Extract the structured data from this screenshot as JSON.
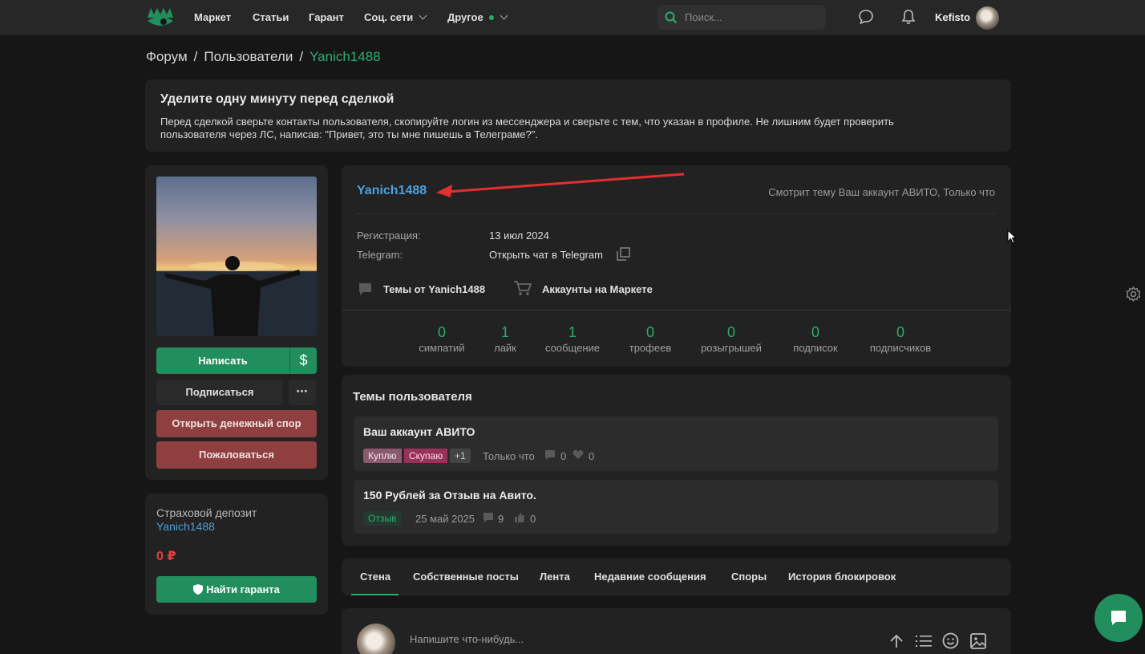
{
  "nav": {
    "items": [
      "Маркет",
      "Статьи",
      "Гарант",
      "Соц. сети",
      "Другое"
    ],
    "search_placeholder": "Поиск...",
    "username": "Kefisto"
  },
  "breadcrumb": [
    "Форум",
    "Пользователи",
    "Yanich1488"
  ],
  "notice": {
    "title": "Уделите одну минуту перед сделкой",
    "text": "Перед сделкой сверьте контакты пользователя, скопируйте логин из мессенджера и сверьте с тем, что указан в профиле. Не лишним будет проверить пользователя через ЛС, написав: \"Привет, это ты мне пишешь в Телеграме?\"."
  },
  "sidebar": {
    "write": "Написать",
    "currency_icon": "$",
    "subscribe": "Подписаться",
    "more": "•••",
    "dispute": "Открыть денежный спор",
    "report": "Пожаловаться",
    "deposit_title": "Страховой депозит",
    "deposit_user": "Yanich1488",
    "deposit_amount": "0 ₽",
    "find_guarantor": "Найти гаранта"
  },
  "profile": {
    "name": "Yanich1488",
    "status": "Смотрит тему Ваш аккаунт АВИТО, Только что",
    "reg_label": "Регистрация:",
    "reg_value": "13 июл 2024",
    "tg_label": "Telegram:",
    "tg_value": "Открыть чат в Telegram",
    "threads_link": "Темы от Yanich1488",
    "market_link": "Аккаунты на Маркете",
    "stats": [
      {
        "num": "0",
        "label": "симпатий"
      },
      {
        "num": "1",
        "label": "лайк"
      },
      {
        "num": "1",
        "label": "сообщение"
      },
      {
        "num": "0",
        "label": "трофеев"
      },
      {
        "num": "0",
        "label": "розыгрышей"
      },
      {
        "num": "0",
        "label": "подписок"
      },
      {
        "num": "0",
        "label": "подписчиков"
      }
    ]
  },
  "threads": {
    "title": "Темы пользователя",
    "items": [
      {
        "title": "Ваш аккаунт АВИТО",
        "tags": [
          "Куплю",
          "Скупаю",
          "+1"
        ],
        "time": "Только что",
        "replies": "0",
        "likes": "0"
      },
      {
        "title": "150 Рублей за Отзыв на Авито.",
        "tags": [
          "Отзыв"
        ],
        "time": "25 май 2025",
        "replies": "9",
        "likes": "0"
      }
    ]
  },
  "tabs": [
    "Стена",
    "Собственные посты",
    "Лента",
    "Недавние сообщения",
    "Споры",
    "История блокировок"
  ],
  "composer": {
    "placeholder": "Напишите что-нибудь..."
  },
  "colors": {
    "accent": "#2bad72",
    "link": "#4ba2e0",
    "danger": "#8f3f40"
  }
}
